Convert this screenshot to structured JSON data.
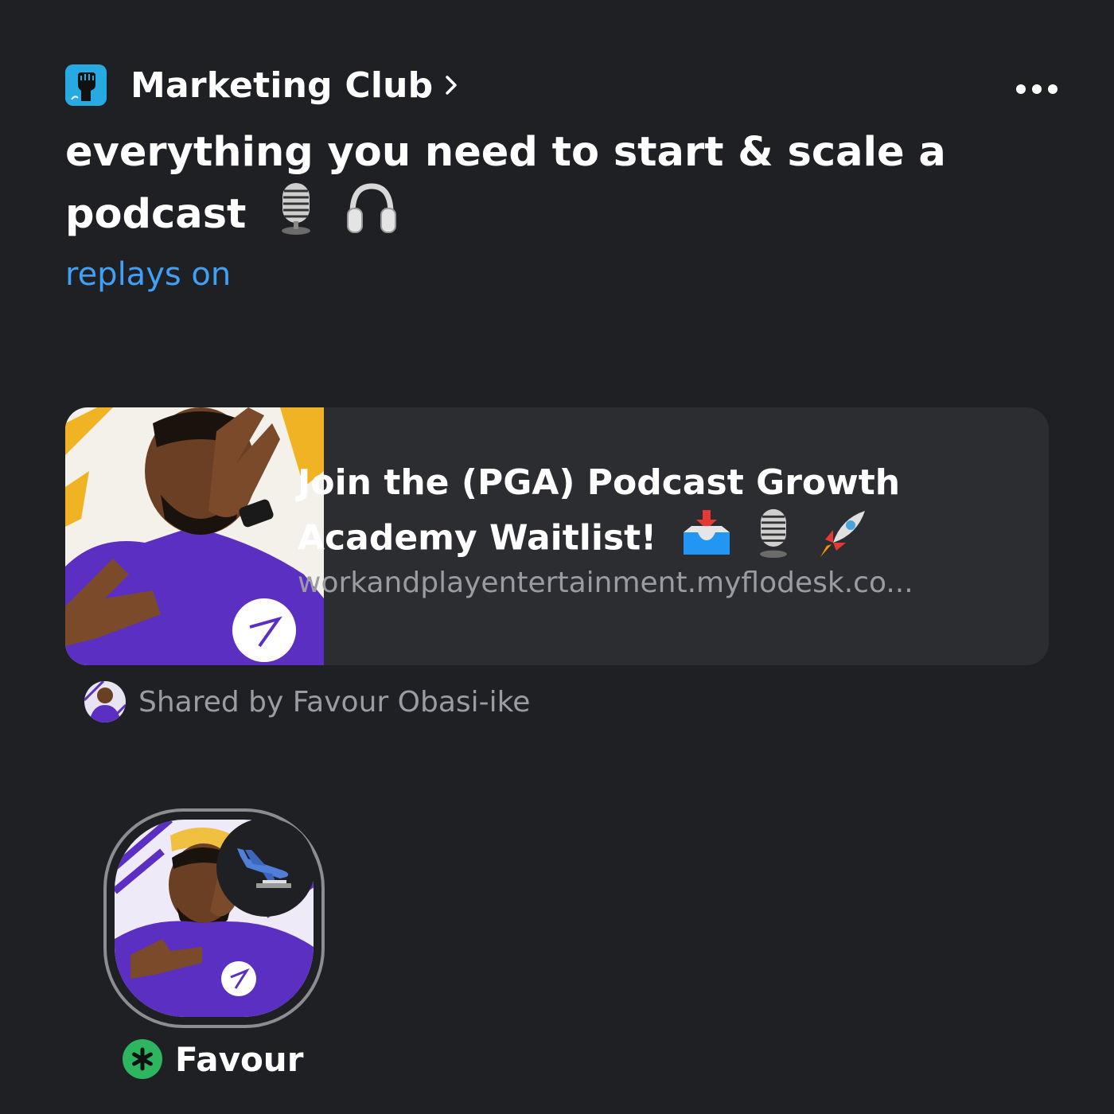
{
  "header": {
    "club_name": "Marketing Club",
    "club_icon": "raised-fist-icon",
    "more_icon": "more-dots-icon"
  },
  "room": {
    "title": "everything you need to start & scale a podcast",
    "title_emojis": [
      "studio-microphone-icon",
      "headphones-icon"
    ],
    "replays_label": "replays on"
  },
  "link_card": {
    "title": "Join the (PGA) Podcast Growth Academy Waitlist!",
    "title_emojis": [
      "inbox-tray-icon",
      "studio-microphone-icon",
      "rocket-icon"
    ],
    "url": "workandplayentertainment.myflodesk.co..."
  },
  "shared": {
    "label": "Shared by Favour Obasi-ike"
  },
  "speaker": {
    "name": "Favour",
    "badge_icon": "airplane-icon",
    "role_icon": "moderator-asterisk-icon"
  },
  "colors": {
    "background": "#1f2023",
    "card": "#2c2d31",
    "link_blue": "#3fa0f5",
    "muted_text": "#9b9ca2",
    "moderator_green": "#2db560",
    "hoodie_purple": "#5b2fc2"
  }
}
